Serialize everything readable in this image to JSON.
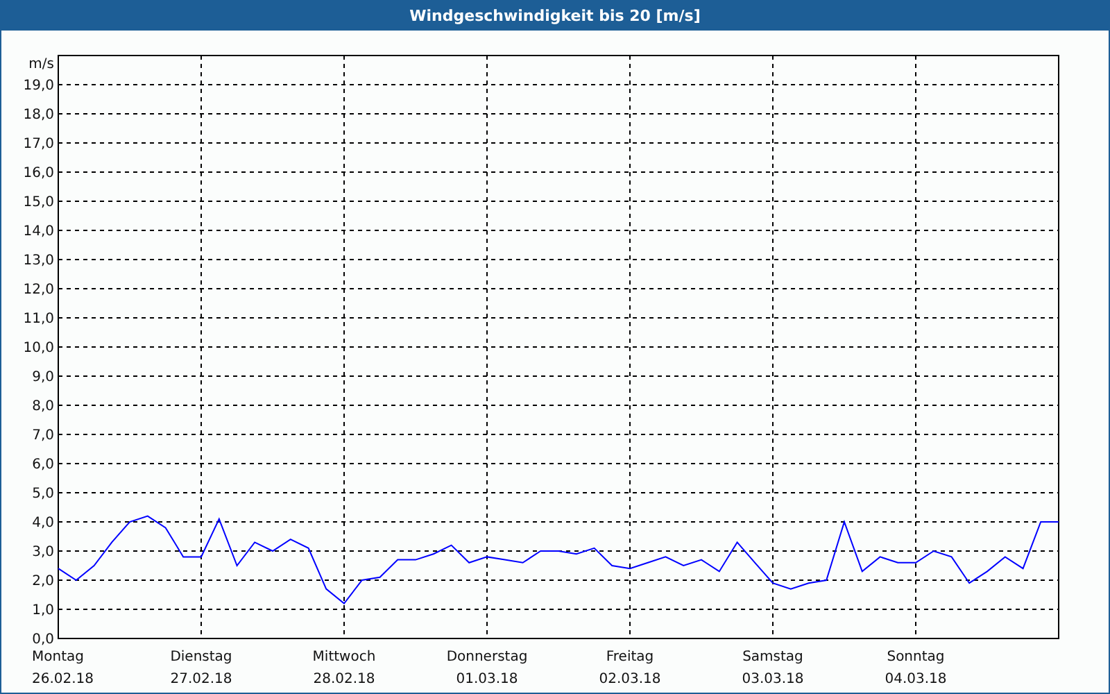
{
  "chart_data": {
    "type": "line",
    "title": "Windgeschwindigkeit bis 20 [m/s]",
    "ylabel": "m/s",
    "categories": [
      "Montag\n26.02.18",
      null,
      null,
      null,
      null,
      null,
      null,
      null,
      "Dienstag\n27.02.18",
      null,
      null,
      null,
      null,
      null,
      null,
      null,
      "Mittwoch\n28.02.18",
      null,
      null,
      null,
      null,
      null,
      null,
      null,
      "Donnerstag\n01.03.18",
      null,
      null,
      null,
      null,
      null,
      null,
      null,
      "Freitag\n02.03.18",
      null,
      null,
      null,
      null,
      null,
      null,
      null,
      "Samstag\n03.03.18",
      null,
      null,
      null,
      null,
      null,
      null,
      null,
      "Sonntag\n04.03.18",
      null,
      null,
      null,
      null,
      null,
      null,
      null,
      null
    ],
    "series": [
      {
        "color": "#0000ff",
        "values": [
          2.4,
          2.0,
          2.5,
          3.3,
          4.0,
          4.2,
          3.8,
          2.8,
          2.8,
          4.1,
          2.5,
          3.3,
          3.0,
          3.4,
          3.1,
          1.7,
          1.2,
          2.0,
          2.1,
          2.7,
          2.7,
          2.9,
          3.2,
          2.6,
          2.8,
          2.7,
          2.6,
          3.0,
          3.0,
          2.9,
          3.1,
          2.5,
          2.4,
          2.6,
          2.8,
          2.5,
          2.7,
          2.3,
          3.3,
          2.6,
          1.9,
          1.7,
          1.9,
          2.0,
          4.0,
          2.3,
          2.8,
          2.6,
          2.6,
          3.0,
          2.8,
          1.9,
          2.3,
          2.8,
          2.4,
          4.0,
          4.0
        ]
      }
    ],
    "ylim": [
      0,
      20
    ],
    "grid": true,
    "yticks": [
      {
        "value": 0,
        "label": "0,0"
      },
      {
        "value": 1,
        "label": "1,0"
      },
      {
        "value": 2,
        "label": "2,0"
      },
      {
        "value": 3,
        "label": "3,0"
      },
      {
        "value": 4,
        "label": "4,0"
      },
      {
        "value": 5,
        "label": "5,0"
      },
      {
        "value": 6,
        "label": "6,0"
      },
      {
        "value": 7,
        "label": "7,0"
      },
      {
        "value": 8,
        "label": "8,0"
      },
      {
        "value": 9,
        "label": "9,0"
      },
      {
        "value": 10,
        "label": "10,0"
      },
      {
        "value": 11,
        "label": "11,0"
      },
      {
        "value": 12,
        "label": "12,0"
      },
      {
        "value": 13,
        "label": "13,0"
      },
      {
        "value": 14,
        "label": "14,0"
      },
      {
        "value": 15,
        "label": "15,0"
      },
      {
        "value": 16,
        "label": "16,0"
      },
      {
        "value": 17,
        "label": "17,0"
      },
      {
        "value": 18,
        "label": "18,0"
      },
      {
        "value": 19,
        "label": "19,0"
      }
    ]
  }
}
